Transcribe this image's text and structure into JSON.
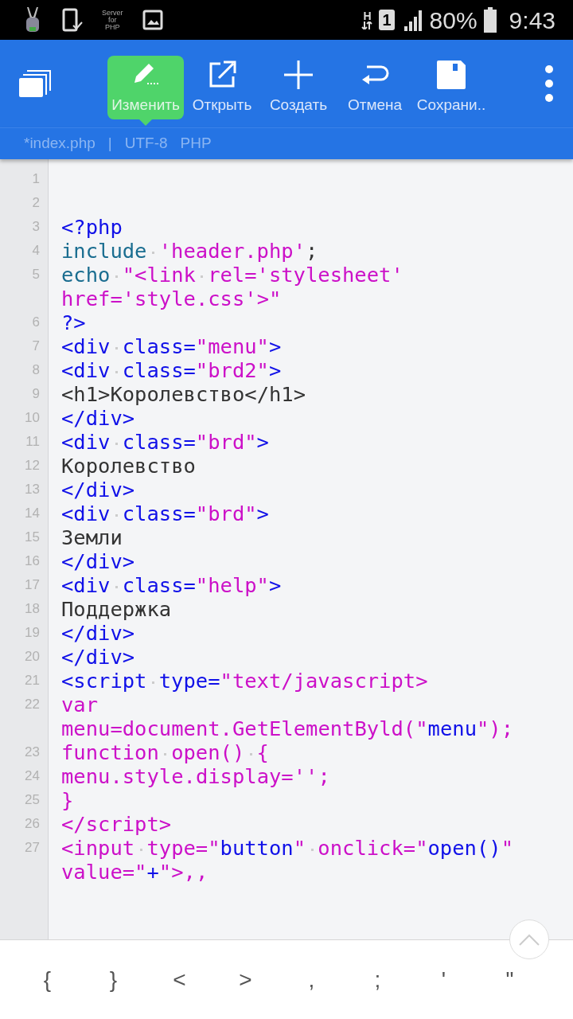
{
  "status_bar": {
    "app_label": [
      "Server",
      "for",
      "PHP"
    ],
    "network": "H",
    "sim": "1",
    "battery": "80%",
    "time": "9:43"
  },
  "toolbar": {
    "actions": [
      {
        "label": "Изменить",
        "selected": true
      },
      {
        "label": "Открыть",
        "selected": false
      },
      {
        "label": "Создать",
        "selected": false
      },
      {
        "label": "Отмена",
        "selected": false
      },
      {
        "label": "Сохрани..",
        "selected": false
      }
    ]
  },
  "file_bar": [
    "*index.php",
    "|",
    "UTF-8",
    "PHP"
  ],
  "lines": [
    {
      "number": "1",
      "rows": [
        []
      ]
    },
    {
      "number": "2",
      "rows": [
        []
      ]
    },
    {
      "number": "3",
      "rows": [
        [
          {
            "text": "<?php",
            "kind": "tag"
          }
        ]
      ]
    },
    {
      "number": "4",
      "rows": [
        [
          {
            "text": "include",
            "kind": "keyword"
          },
          {
            "kind": "space"
          },
          {
            "text": "'header.php'",
            "kind": "string"
          },
          {
            "text": ";",
            "kind": "plain"
          }
        ]
      ]
    },
    {
      "number": "5",
      "rows": [
        [
          {
            "text": "echo",
            "kind": "keyword"
          },
          {
            "kind": "space"
          },
          {
            "text": "\"<link",
            "kind": "string"
          },
          {
            "kind": "space"
          },
          {
            "text": "rel='stylesheet'",
            "kind": "string"
          }
        ],
        [
          {
            "text": "href='style.css'>\"",
            "kind": "string"
          }
        ]
      ]
    },
    {
      "number": "6",
      "rows": [
        [
          {
            "text": "?>",
            "kind": "tag"
          }
        ]
      ]
    },
    {
      "number": "7",
      "rows": [
        [
          {
            "text": "<div",
            "kind": "tag"
          },
          {
            "kind": "space"
          },
          {
            "text": "class=",
            "kind": "tag"
          },
          {
            "text": "\"menu\"",
            "kind": "string"
          },
          {
            "text": ">",
            "kind": "tag"
          }
        ]
      ]
    },
    {
      "number": "8",
      "rows": [
        [
          {
            "text": "<div",
            "kind": "tag"
          },
          {
            "kind": "space"
          },
          {
            "text": "class=",
            "kind": "tag"
          },
          {
            "text": "\"brd2\"",
            "kind": "string"
          },
          {
            "text": ">",
            "kind": "tag"
          }
        ]
      ]
    },
    {
      "number": "9",
      "rows": [
        [
          {
            "text": "<h1>Королевство</h1>",
            "kind": "plain"
          }
        ]
      ]
    },
    {
      "number": "10",
      "rows": [
        [
          {
            "text": "</div>",
            "kind": "tag"
          }
        ]
      ]
    },
    {
      "number": "11",
      "rows": [
        [
          {
            "text": "<div",
            "kind": "tag"
          },
          {
            "kind": "space"
          },
          {
            "text": "class=",
            "kind": "tag"
          },
          {
            "text": "\"brd\"",
            "kind": "string"
          },
          {
            "text": ">",
            "kind": "tag"
          }
        ]
      ]
    },
    {
      "number": "12",
      "rows": [
        [
          {
            "text": "Королевство",
            "kind": "plain"
          }
        ]
      ]
    },
    {
      "number": "13",
      "rows": [
        [
          {
            "text": "</div>",
            "kind": "tag"
          }
        ]
      ]
    },
    {
      "number": "14",
      "rows": [
        [
          {
            "text": "<div",
            "kind": "tag"
          },
          {
            "kind": "space"
          },
          {
            "text": "class=",
            "kind": "tag"
          },
          {
            "text": "\"brd\"",
            "kind": "string"
          },
          {
            "text": ">",
            "kind": "tag"
          }
        ]
      ]
    },
    {
      "number": "15",
      "rows": [
        [
          {
            "text": "Земли",
            "kind": "plain"
          }
        ]
      ]
    },
    {
      "number": "16",
      "rows": [
        [
          {
            "text": "</div>",
            "kind": "tag"
          }
        ]
      ]
    },
    {
      "number": "17",
      "rows": [
        [
          {
            "text": "<div",
            "kind": "tag"
          },
          {
            "kind": "space"
          },
          {
            "text": "class=",
            "kind": "tag"
          },
          {
            "text": "\"help\"",
            "kind": "string"
          },
          {
            "text": ">",
            "kind": "tag"
          }
        ]
      ]
    },
    {
      "number": "18",
      "rows": [
        [
          {
            "text": "Поддержка",
            "kind": "plain"
          }
        ]
      ]
    },
    {
      "number": "19",
      "rows": [
        [
          {
            "text": "</div>",
            "kind": "tag"
          }
        ]
      ]
    },
    {
      "number": "20",
      "rows": [
        [
          {
            "text": "</div>",
            "kind": "tag"
          }
        ]
      ]
    },
    {
      "number": "21",
      "rows": [
        [
          {
            "text": "<script",
            "kind": "tag"
          },
          {
            "kind": "space"
          },
          {
            "text": "type=",
            "kind": "tag"
          },
          {
            "text": "\"text/javascript>",
            "kind": "string"
          }
        ]
      ]
    },
    {
      "number": "22",
      "rows": [
        [
          {
            "text": "var",
            "kind": "string"
          }
        ],
        [
          {
            "text": "menu=document.GetElementByld(\"",
            "kind": "string"
          },
          {
            "text": "menu",
            "kind": "tag"
          },
          {
            "text": "\");",
            "kind": "string"
          }
        ]
      ]
    },
    {
      "number": "23",
      "rows": [
        [
          {
            "text": "function",
            "kind": "string"
          },
          {
            "kind": "space"
          },
          {
            "text": "open()",
            "kind": "string"
          },
          {
            "kind": "space"
          },
          {
            "text": "{",
            "kind": "string"
          }
        ]
      ]
    },
    {
      "number": "24",
      "rows": [
        [
          {
            "text": "menu.style.display='';",
            "kind": "string"
          }
        ]
      ]
    },
    {
      "number": "25",
      "rows": [
        [
          {
            "text": "}",
            "kind": "string"
          }
        ]
      ]
    },
    {
      "number": "26",
      "rows": [
        [
          {
            "text": "</script>",
            "kind": "string"
          }
        ]
      ]
    },
    {
      "number": "27",
      "rows": [
        [
          {
            "text": "<input",
            "kind": "string"
          },
          {
            "kind": "space"
          },
          {
            "text": "type=\"",
            "kind": "string"
          },
          {
            "text": "button",
            "kind": "tag"
          },
          {
            "text": "\"",
            "kind": "string"
          },
          {
            "kind": "space"
          },
          {
            "text": "onclick=\"",
            "kind": "string"
          },
          {
            "text": "open()",
            "kind": "tag"
          },
          {
            "text": "\"",
            "kind": "string"
          }
        ],
        [
          {
            "text": "value=\"",
            "kind": "string"
          },
          {
            "text": "+",
            "kind": "tag"
          },
          {
            "text": "\">,,",
            "kind": "string"
          }
        ]
      ]
    }
  ],
  "symbol_keys": [
    "{",
    "}",
    "<",
    ">",
    ",",
    ";",
    "'",
    "\""
  ]
}
